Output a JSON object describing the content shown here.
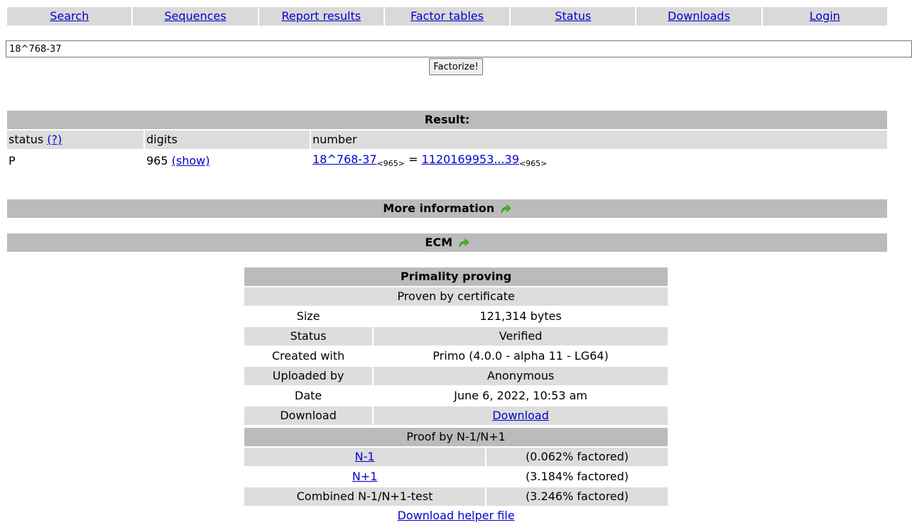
{
  "nav": {
    "items": [
      "Search",
      "Sequences",
      "Report results",
      "Factor tables",
      "Status",
      "Downloads",
      "Login"
    ]
  },
  "search": {
    "value": "18^768-37",
    "button_label": "Factorize!"
  },
  "result": {
    "title": "Result:",
    "headers": {
      "status": "status",
      "help_link": "(?)",
      "digits": "digits",
      "number": "number"
    },
    "row": {
      "status": "P",
      "digits": "965",
      "show_link": "(show)",
      "expression": "18^768-37",
      "expression_sub": "<965>",
      "equals": " = ",
      "value": "1120169953...39",
      "value_sub": "<965>"
    }
  },
  "more_info": {
    "label": "More information"
  },
  "ecm": {
    "label": "ECM"
  },
  "primality": {
    "title": "Primality proving",
    "subtitle": "Proven by certificate",
    "rows": [
      {
        "label": "Size",
        "value": "121,314 bytes"
      },
      {
        "label": "Status",
        "value": "Verified"
      },
      {
        "label": "Created with",
        "value": "Primo (4.0.0 - alpha 11 - LG64)"
      },
      {
        "label": "Uploaded by",
        "value": "Anonymous"
      },
      {
        "label": "Date",
        "value": "June 6, 2022, 10:53 am"
      },
      {
        "label": "Download",
        "value": "Download"
      }
    ],
    "proof_title": "Proof by N-1/N+1",
    "proof_rows": [
      {
        "label": "N-1",
        "value": "(0.062% factored)"
      },
      {
        "label": "N+1",
        "value": "(3.184% factored)"
      },
      {
        "label": "Combined N-1/N+1-test",
        "value": "(3.246% factored)"
      }
    ],
    "helper_link": "Download helper file"
  },
  "colors": {
    "link": "#0000cc",
    "bar": "#bbbbbb",
    "cell": "#dddddd",
    "nav": "#d9d9d9",
    "icon": "#44bb22"
  }
}
